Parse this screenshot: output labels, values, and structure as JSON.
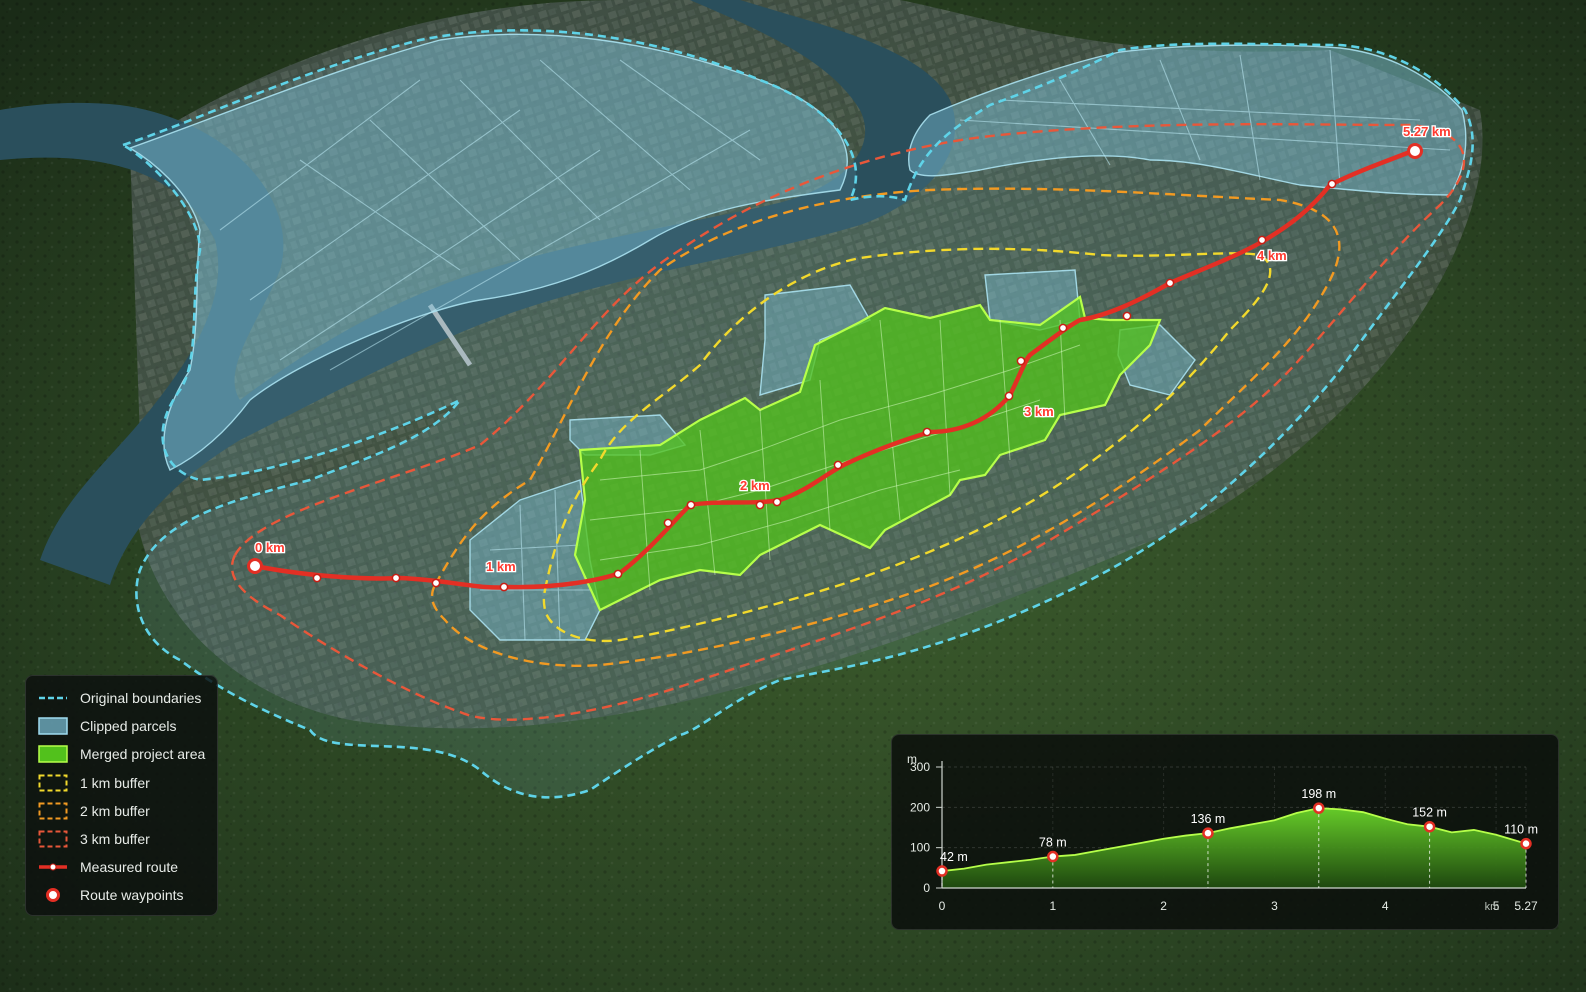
{
  "colors": {
    "original_boundary": "#5fd3e8",
    "clipped_parcel_fill": "#7ec3dc",
    "merged_area_fill": "#52c11c",
    "merged_area_edge": "#b6ff4a",
    "buffer_1km": "#f2d92c",
    "buffer_2km": "#f29a22",
    "buffer_3km": "#e8573a",
    "route": "#e32f24",
    "river": "#2a4f5c",
    "terrain": "#2d4524"
  },
  "map": {
    "route_labels": [
      "0 km",
      "1 km",
      "2 km",
      "3 km",
      "4 km",
      "5.27 km"
    ]
  },
  "legend": {
    "items": [
      {
        "label": "Original boundaries",
        "symbol": "dashed-cyan-line"
      },
      {
        "label": "Clipped parcels",
        "symbol": "blue-filled-box"
      },
      {
        "label": "Merged project area",
        "symbol": "green-filled-box"
      },
      {
        "label": "1 km buffer",
        "symbol": "dashed-yellow-box"
      },
      {
        "label": "2 km buffer",
        "symbol": "dashed-orange-box"
      },
      {
        "label": "3 km buffer",
        "symbol": "dashed-red-box"
      },
      {
        "label": "Measured route",
        "symbol": "red-line-with-dot"
      },
      {
        "label": "Route waypoints",
        "symbol": "red-ring-dot"
      }
    ]
  },
  "chart_data": {
    "type": "area",
    "title": "",
    "xlabel": "",
    "ylabel": "m",
    "x_unit": "km",
    "xlim": [
      0,
      5.27
    ],
    "ylim": [
      0,
      300
    ],
    "x_ticks": [
      "0",
      "1",
      "2",
      "3",
      "4",
      "5",
      "5.27"
    ],
    "y_ticks": [
      "0",
      "100",
      "200",
      "300"
    ],
    "grid": true,
    "series": [
      {
        "x": [
          0,
          0.2,
          0.4,
          0.6,
          0.8,
          1.0,
          1.2,
          1.4,
          1.6,
          1.8,
          2.0,
          2.2,
          2.4,
          2.6,
          2.8,
          3.0,
          3.2,
          3.4,
          3.6,
          3.8,
          4.0,
          4.2,
          4.4,
          4.6,
          4.8,
          5.0,
          5.27
        ],
        "y": [
          42,
          48,
          58,
          64,
          70,
          78,
          82,
          92,
          102,
          112,
          122,
          130,
          136,
          148,
          158,
          168,
          186,
          198,
          195,
          188,
          172,
          158,
          152,
          138,
          144,
          132,
          110
        ]
      }
    ],
    "labeled_points": [
      {
        "x": 0,
        "y": 42,
        "label": "42 m"
      },
      {
        "x": 1.0,
        "y": 78,
        "label": "78 m"
      },
      {
        "x": 2.4,
        "y": 136,
        "label": "136 m"
      },
      {
        "x": 3.4,
        "y": 198,
        "label": "198 m"
      },
      {
        "x": 4.4,
        "y": 152,
        "label": "152 m"
      },
      {
        "x": 5.27,
        "y": 110,
        "label": "110 m"
      }
    ]
  }
}
